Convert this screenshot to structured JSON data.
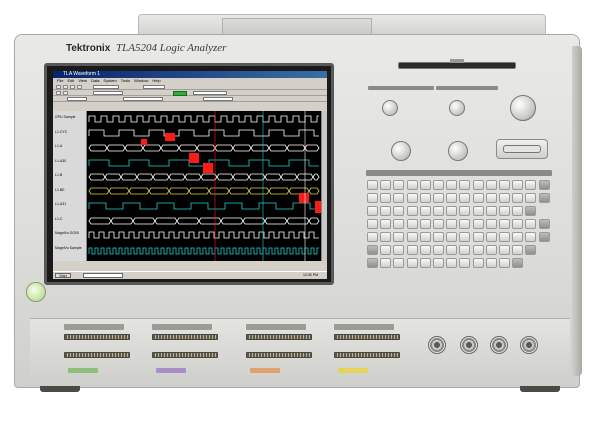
{
  "instrument": {
    "brand": "Tektronix",
    "model": "TLA5204 Logic Analyzer"
  },
  "screen": {
    "window_title": "TLA Waveform 1",
    "menu": [
      "File",
      "Edit",
      "View",
      "Data",
      "System",
      "Tools",
      "Window",
      "Help"
    ],
    "signal_labels": [
      "GPU Sample",
      "L1.CYC",
      "L1.A",
      "L1.A30",
      "L1.B",
      "L1.BE",
      "L1.A31",
      "L1.C",
      "MagniVu GG00",
      "MagniVu Sample"
    ],
    "taskbar_start": "Start",
    "clock": "12:30 PM"
  },
  "colors": {
    "screen_bg": "#000000",
    "trace_white": "#ffffff",
    "trace_cyan": "#1fd3d3",
    "trace_yellow": "#e6d33a",
    "marker_red": "#ff1a1a",
    "run_green": "#2fae3c",
    "power_green": "#c9e6a8"
  },
  "icons": {
    "power": "power-button-icon",
    "bnc": "bnc-connector-icon",
    "knob": "rotary-knob-icon"
  }
}
